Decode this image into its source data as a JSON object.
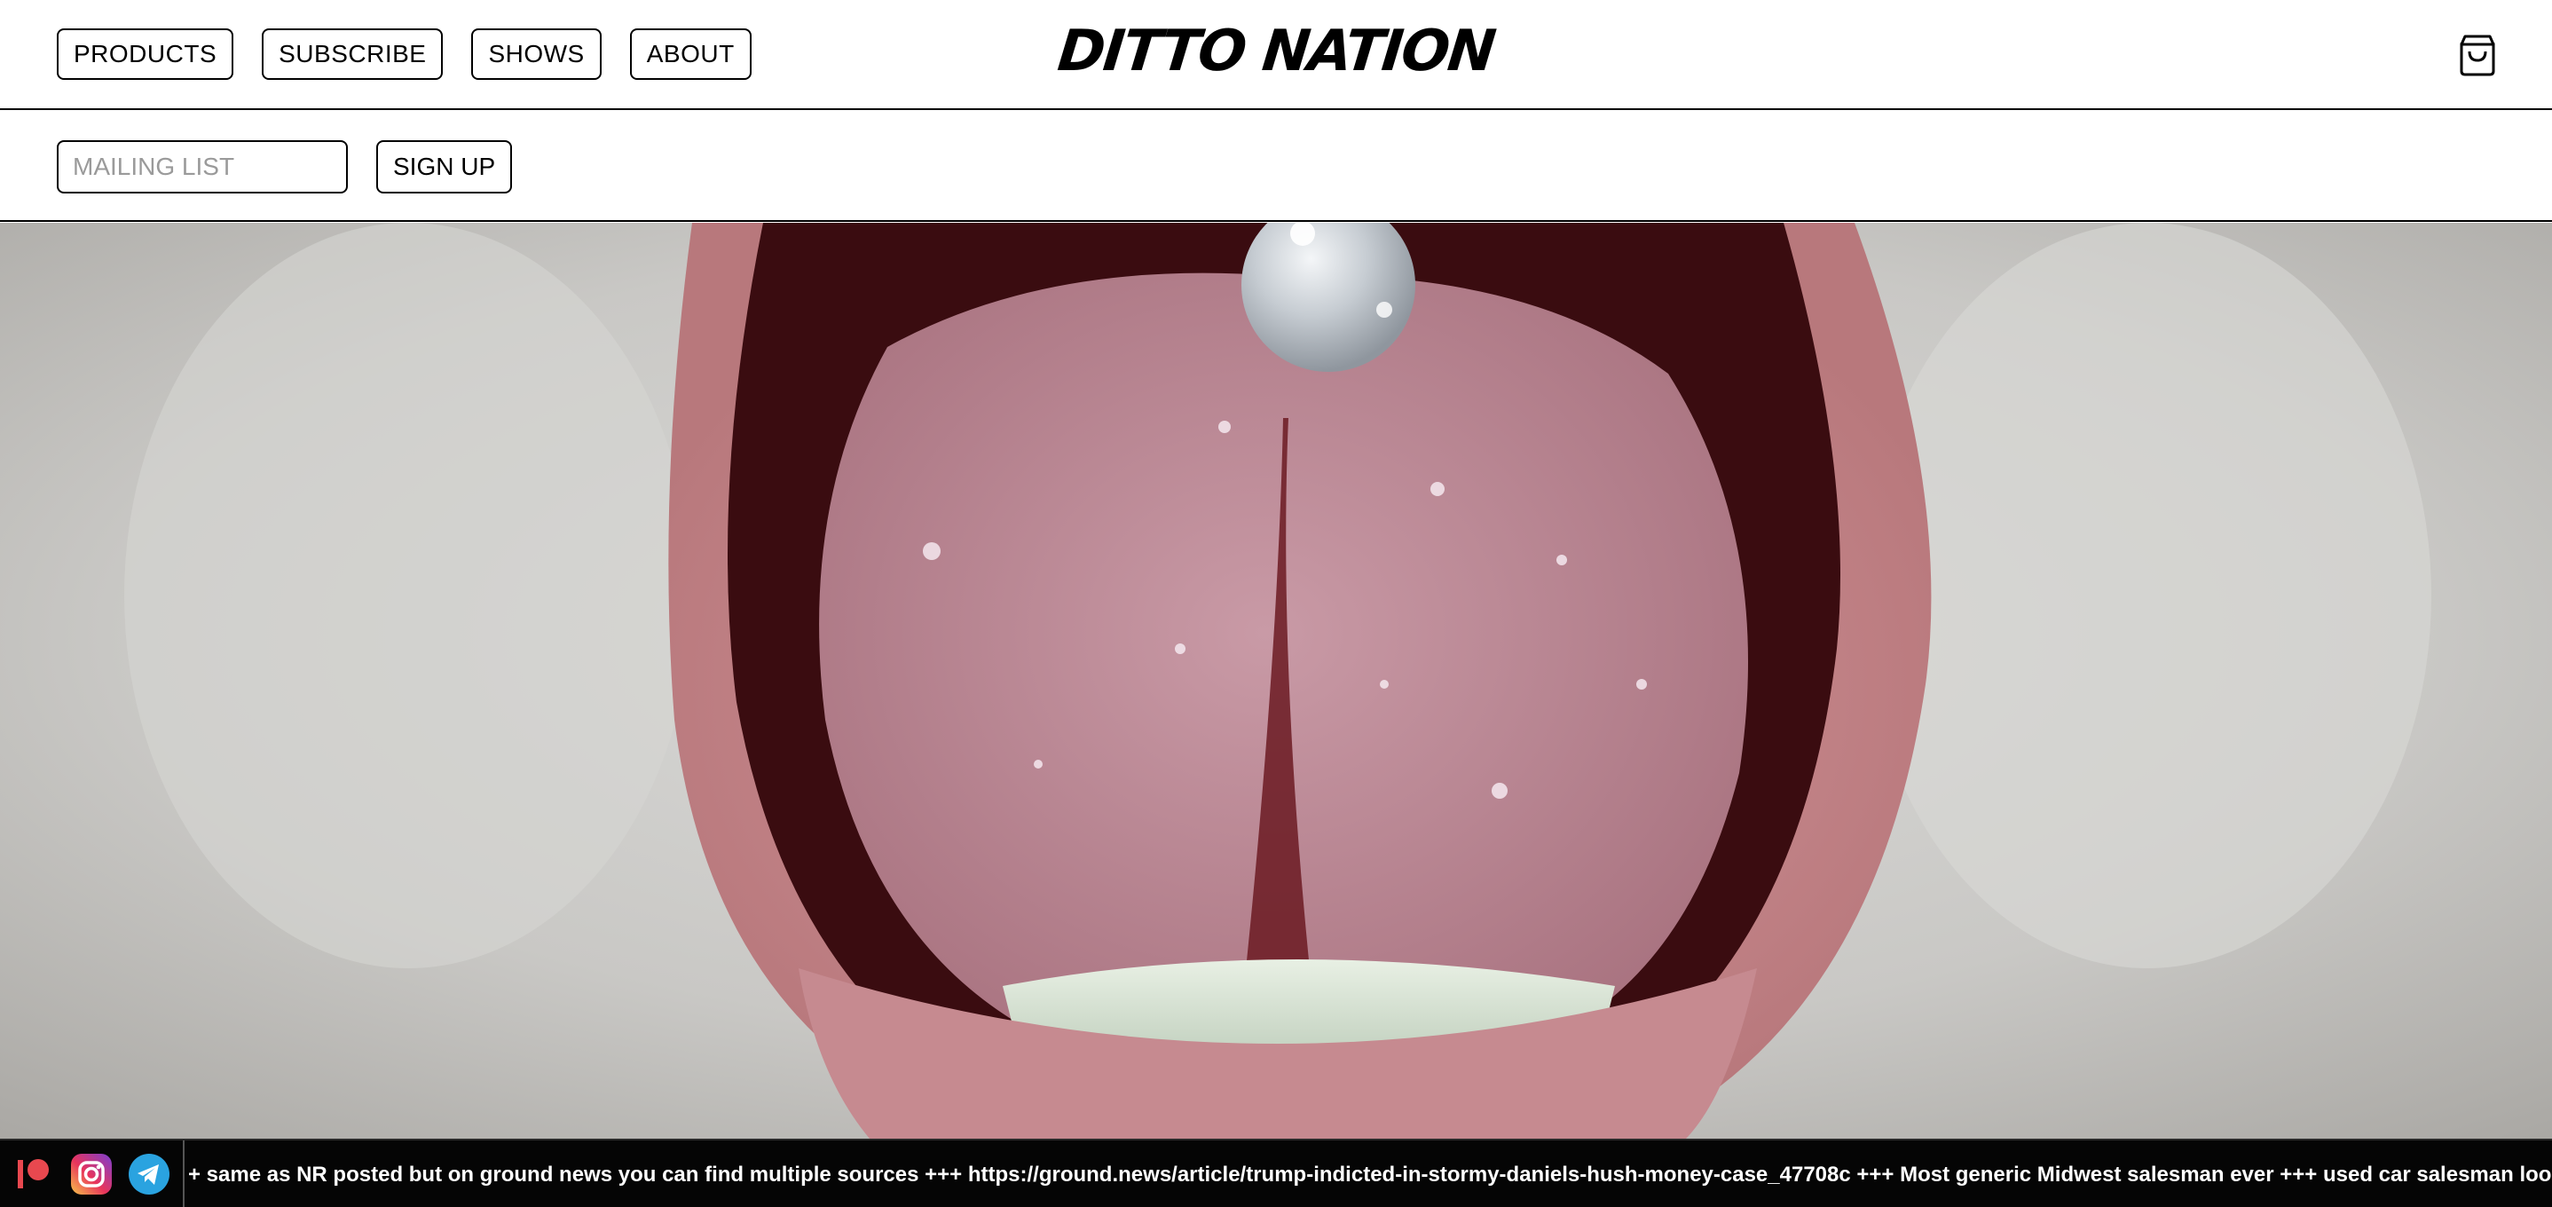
{
  "header": {
    "nav": [
      {
        "label": "PRODUCTS"
      },
      {
        "label": "SUBSCRIBE"
      },
      {
        "label": "SHOWS"
      },
      {
        "label": "ABOUT"
      }
    ],
    "logo": "DITTO NATION",
    "cart_icon": "shopping-bag-icon"
  },
  "mailing": {
    "placeholder": "MAILING LIST",
    "value": "",
    "button": "SIGN UP"
  },
  "hero": {
    "image": "open-mouth-with-tongue-and-pearl"
  },
  "footer": {
    "social_icons": [
      "patreon-icon",
      "instagram-icon",
      "telegram-icon"
    ],
    "ticker": "+ same as NR posted but on ground news you can find multiple sources +++ https://ground.news/article/trump-indicted-in-stormy-daniels-hush-money-case_47708c +++ Most generic Midwest salesman ever +++ used car salesman look +++"
  },
  "colors": {
    "accent": "#000000",
    "ticker_background": "#050505",
    "ticker_text": "#ffffff",
    "patreon": "#e8484f",
    "telegram": "#2aa3e0"
  }
}
